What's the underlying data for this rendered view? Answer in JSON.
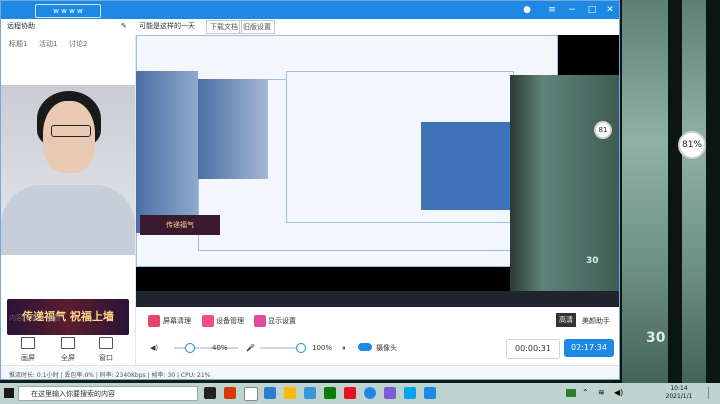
{
  "app": {
    "logo": "ᴡ ᴡ ᴡ ᴡ",
    "toolbar": {
      "left_label": "远程协助",
      "middle_label": "可能是这样的一天",
      "btn_download": "下载文档",
      "btn_record": "旧版设置"
    },
    "leftpane": {
      "tabs": [
        "标题1",
        "活动1",
        "讨论2"
      ],
      "banner_text": "传递福气 祝福上墙",
      "bottom_tabs": [
        "内容设置",
        "设备"
      ],
      "buttons": [
        "画屏",
        "全屏",
        "窗口"
      ]
    },
    "controls": {
      "btn_1": "屏幕清理",
      "btn_2": "设备管理",
      "btn_3": "显示设置",
      "volume": "40%",
      "mic": "100%",
      "camera_label": "摄像头",
      "timer_1": "00:00:31",
      "timer_2": "02:17:34",
      "quality": "高清",
      "beauty": "美颜助手"
    },
    "status": "推流时长: 0:1小时 | 丢包率:0% | 码率: 2340Kbps | 帧率: 30 | CPU: 21%"
  },
  "overlay": {
    "pct_small": "81",
    "pct_large": "81%",
    "logo_small": "30",
    "logo_large": "30"
  },
  "taskbar": {
    "search_placeholder": "在这里输入你要搜索的内容",
    "time": "10:14",
    "date": "2021/1/1"
  }
}
